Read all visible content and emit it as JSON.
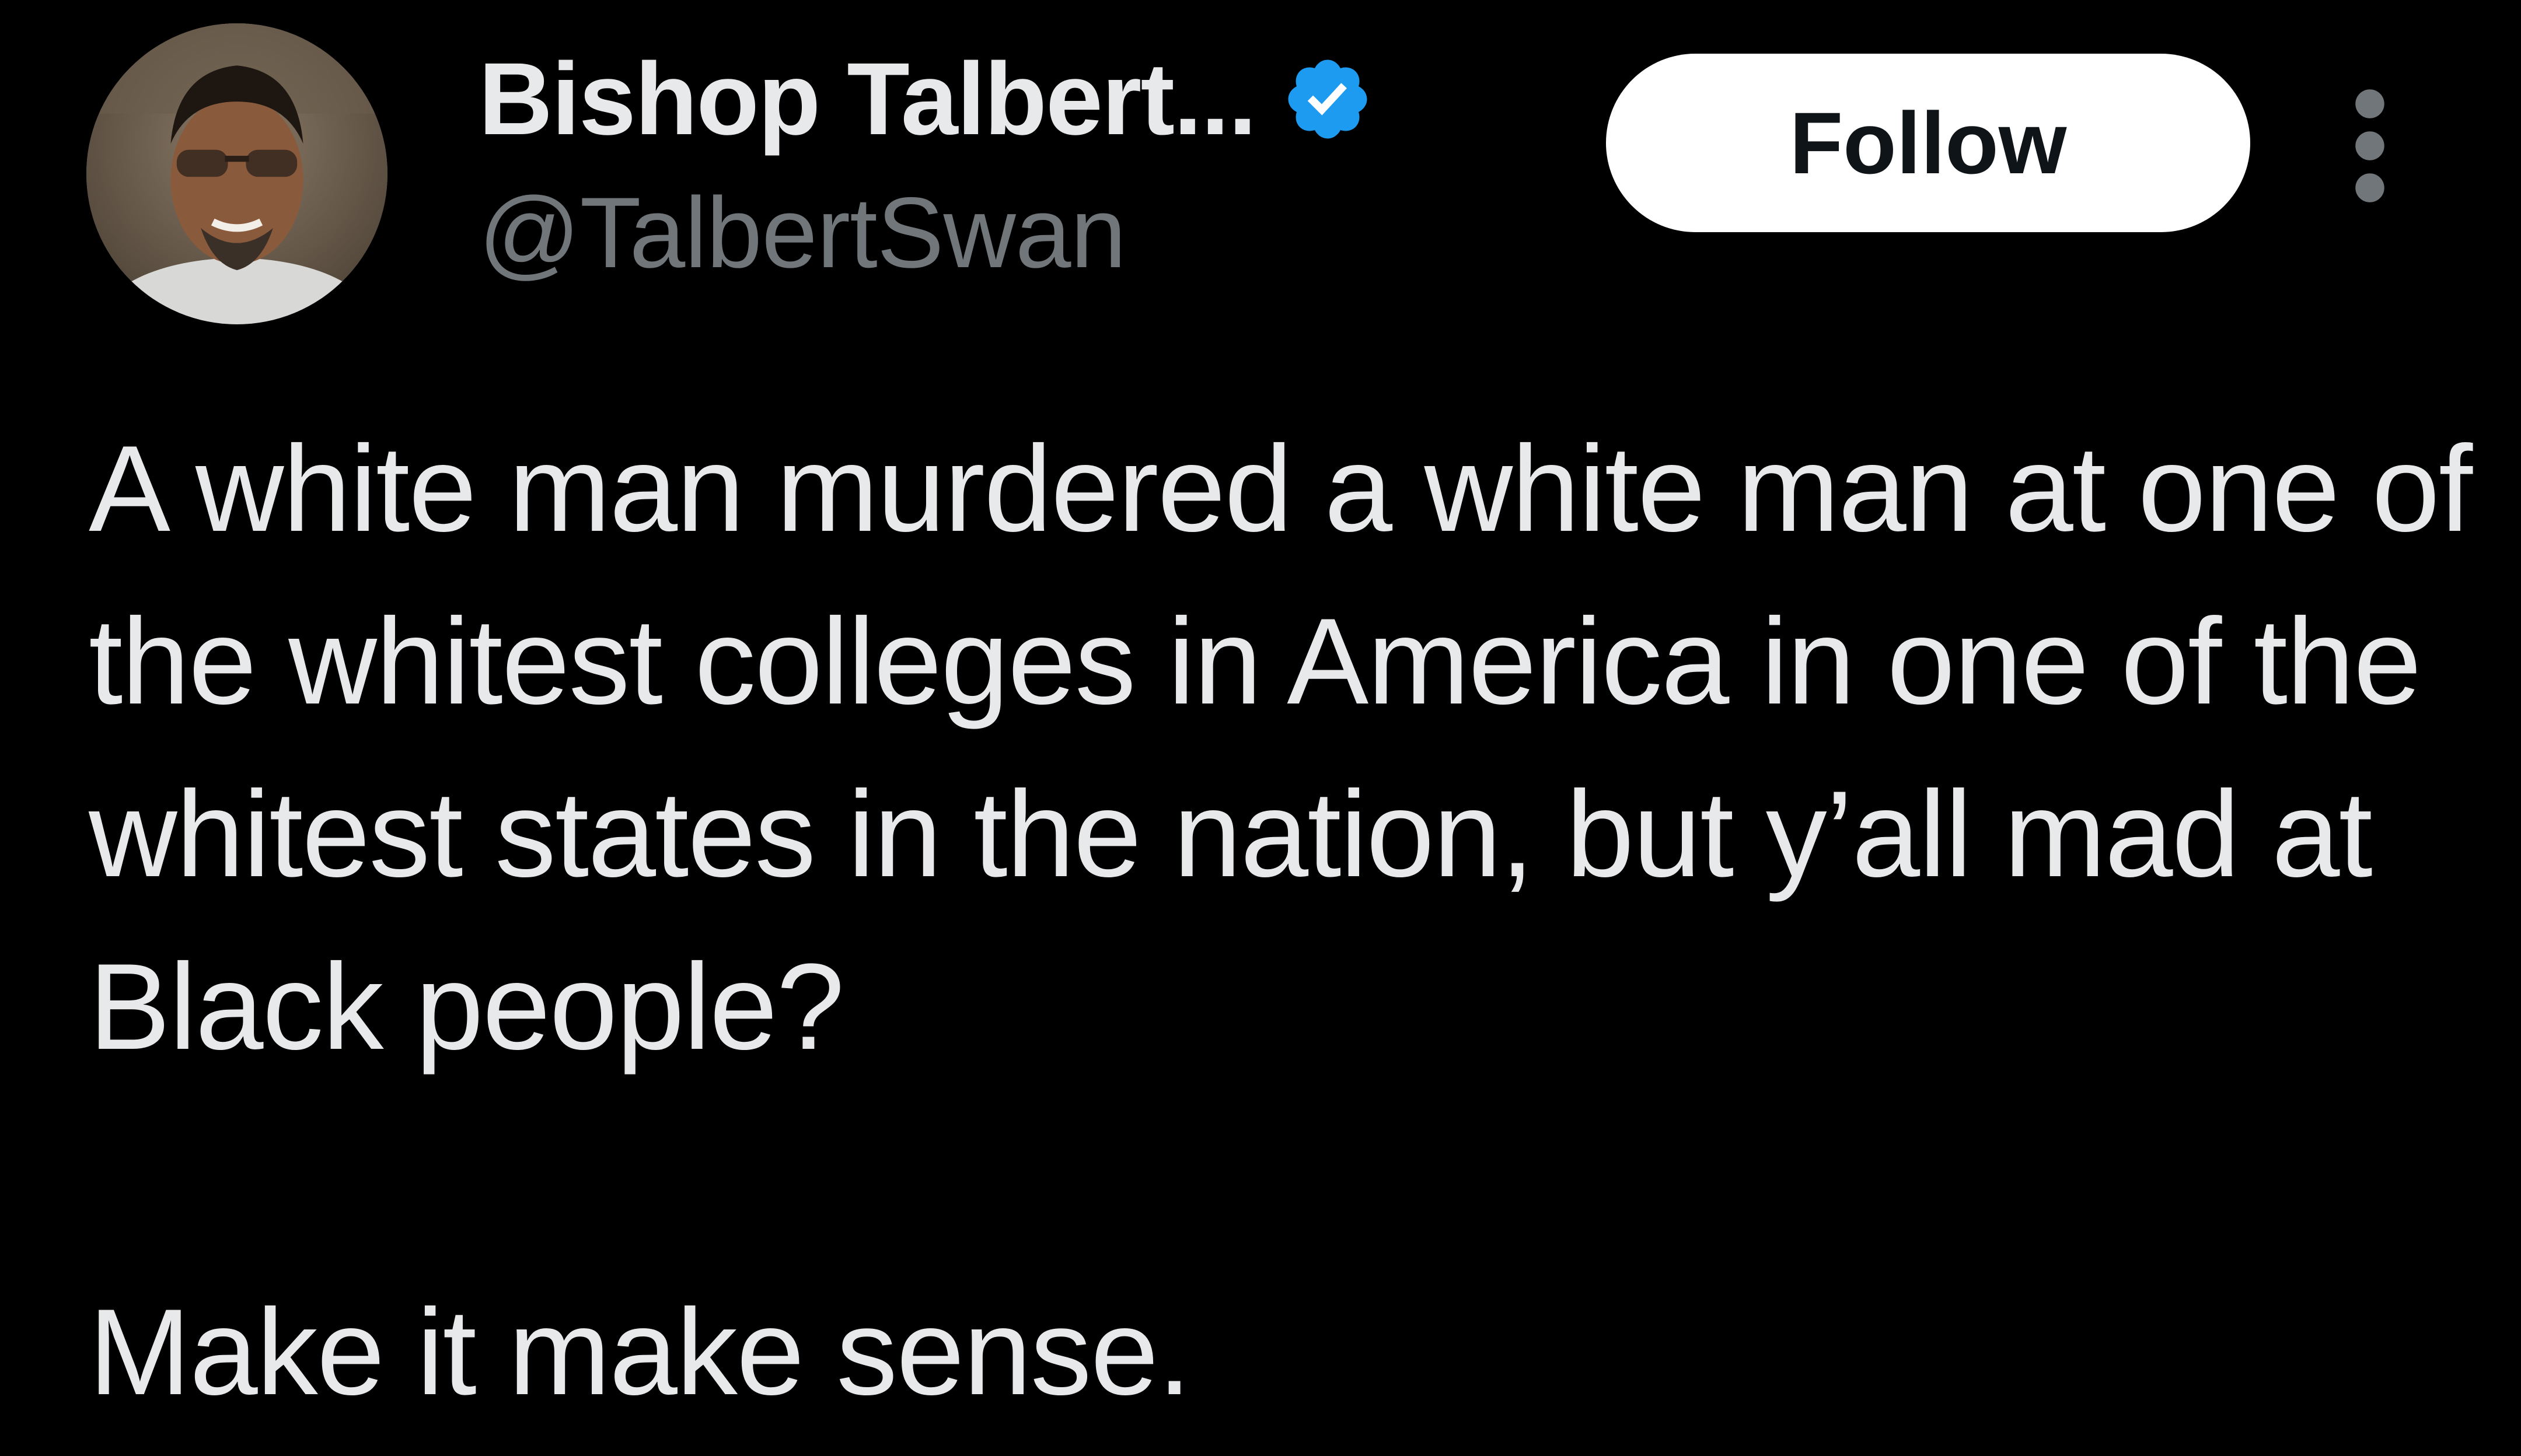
{
  "author": {
    "display_name": "Bishop Talbert...",
    "handle": "@TalbertSwan",
    "verified": true,
    "verified_badge_color": "#1d9bf0",
    "avatar_icon": "profile-photo"
  },
  "actions": {
    "follow_label": "Follow",
    "more_icon": "more-vertical-icon"
  },
  "tweet": {
    "paragraphs": [
      "A white man murdered a white man at one of the whitest colleges in America in one of the whitest states in the nation, but y’all mad at Black people?",
      "Make it make sense."
    ]
  },
  "colors": {
    "background": "#000000",
    "text_primary": "#e7e9ea",
    "text_secondary": "#71767b",
    "button_bg": "#ffffff",
    "button_text": "#0f1419"
  }
}
